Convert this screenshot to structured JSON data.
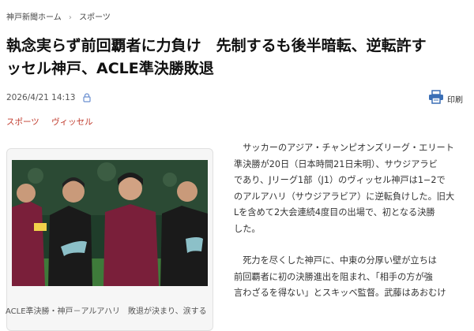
{
  "breadcrumb": {
    "home": "神戸新聞ホーム",
    "separator": "›",
    "section": "スポーツ"
  },
  "headline": {
    "line1": "執念実らず前回覇者に力負け　先制するも後半暗転、逆転許す",
    "line2": "ッセル神戸、ACLE準決勝敗退"
  },
  "meta": {
    "datetime": "2026/4/21 14:13",
    "lock_icon": "lock-icon"
  },
  "print": {
    "icon": "printer-icon",
    "label": "印刷"
  },
  "tags": [
    "スポーツ",
    "ヴィッセル"
  ],
  "photo": {
    "caption": "ACLE準決勝・神戸－アルアハリ　敗退が決まり、涙する"
  },
  "article": {
    "paragraph1": [
      "サッカーのアジア・チャンピオンズリーグ・エリート",
      "準決勝が20日（日本時間21日未明）、サウジアラビ",
      "であり、Jリーグ1部（J1）のヴィッセル神戸は1−2で",
      "のアルアハリ（サウジアラビア）に逆転負けした。旧大",
      "Lを含めて2大会連続4度目の出場で、初となる決勝",
      "した。"
    ],
    "paragraph2": [
      "死力を尽くした神戸に、中東の分厚い壁が立ちは",
      "前回覇者に初の決勝進出を阻まれ、「相手の方が強",
      "言わざるを得ない」とスキッベ監督。武藤はあおむけ"
    ]
  },
  "colors": {
    "accent": "#c0392b",
    "print_icon": "#3b6fb6",
    "lock_icon": "#6a8fd0"
  }
}
